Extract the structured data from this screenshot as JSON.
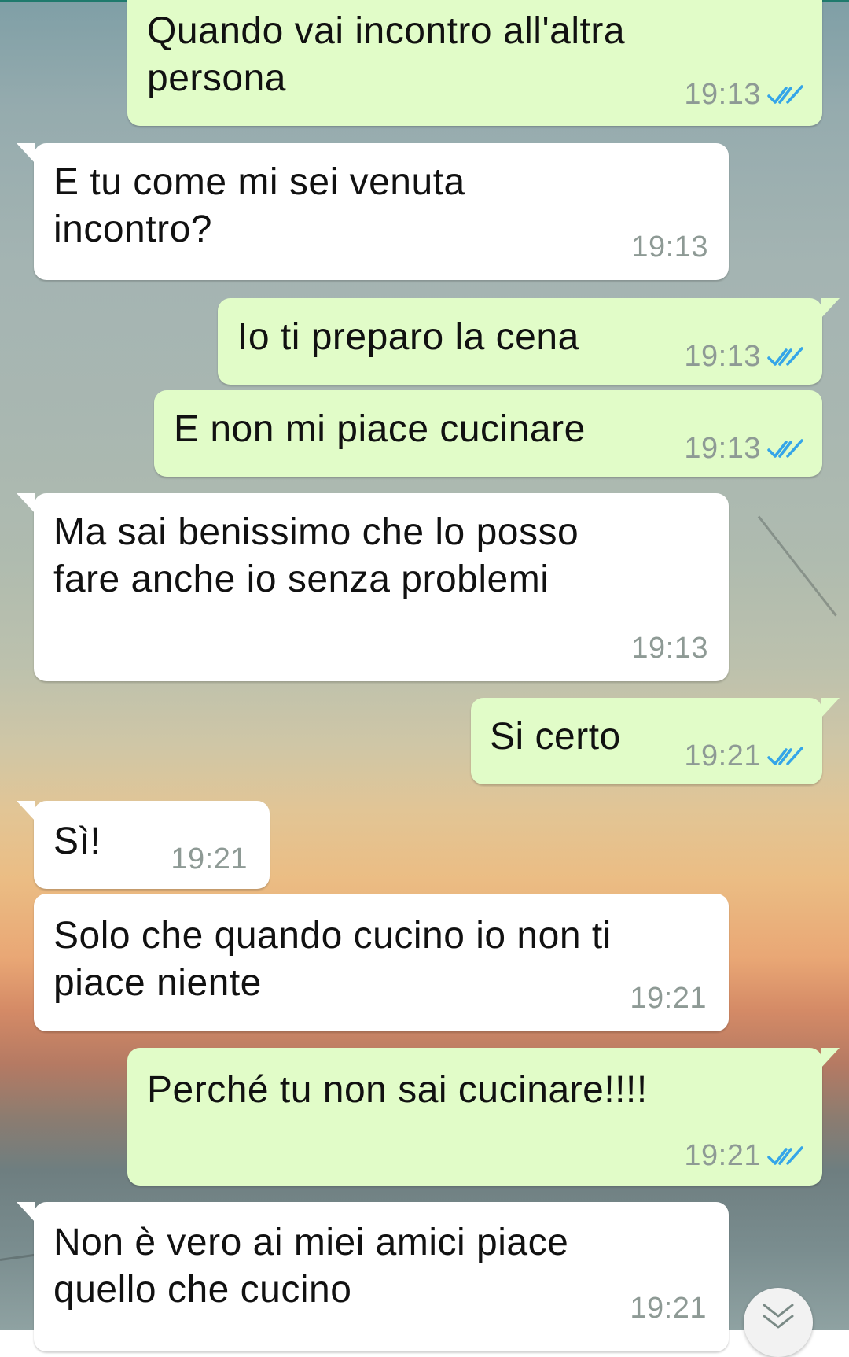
{
  "chat": {
    "messages": [
      {
        "text": "Quando vai incontro all'altra\npersona",
        "time": "19:13"
      },
      {
        "text": "E tu come mi sei venuta\nincontro?",
        "time": "19:13"
      },
      {
        "text": "Io ti preparo la cena",
        "time": "19:13"
      },
      {
        "text": "E non mi piace cucinare",
        "time": "19:13"
      },
      {
        "text": "Ma sai benissimo che lo posso\nfare anche io senza problemi",
        "time": "19:13"
      },
      {
        "text": "Si certo",
        "time": "19:21"
      },
      {
        "text": "Sì!",
        "time": "19:21"
      },
      {
        "text": "Solo che quando cucino io non ti\npiace niente",
        "time": "19:21"
      },
      {
        "text": "Perché tu non sai cucinare!!!!",
        "time": "19:21"
      },
      {
        "text": "Non è vero ai miei amici piace\nquello che cucino",
        "time": "19:21"
      }
    ]
  },
  "icons": {
    "read_receipt": "double-check-icon",
    "scroll_down": "chevron-double-down-icon"
  },
  "colors": {
    "outgoing_bubble": "#e1fcc8",
    "incoming_bubble": "#ffffff",
    "read_tick": "#34a5e8",
    "timestamp": "#8e9a95"
  }
}
